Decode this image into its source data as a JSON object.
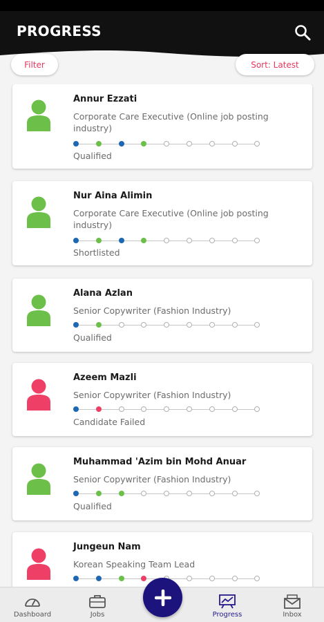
{
  "header": {
    "title": "PROGRESS"
  },
  "filters": {
    "filter_label": "Filter",
    "sort_label": "Sort: Latest"
  },
  "colors": {
    "qualified": "#6cc04a",
    "failed": "#ee3f66",
    "done_step": "#1e68b3",
    "accent": "#e8385e",
    "primary": "#1c137d"
  },
  "candidates": [
    {
      "name": "Annur Ezzati",
      "job": "Corporate Care Executive (Online job posting industry)",
      "status": "Qualified",
      "outcome": "qualified",
      "steps": [
        "done",
        "qualified",
        "done",
        "qualified",
        "pending",
        "pending",
        "pending",
        "pending",
        "pending"
      ]
    },
    {
      "name": "Nur Aina Alimin",
      "job": "Corporate Care Executive (Online job posting industry)",
      "status": "Shortlisted",
      "outcome": "qualified",
      "steps": [
        "done",
        "qualified",
        "done",
        "qualified",
        "pending",
        "pending",
        "pending",
        "pending",
        "pending"
      ]
    },
    {
      "name": "Alana Azlan",
      "job": "Senior Copywriter (Fashion Industry)",
      "status": "Qualified",
      "outcome": "qualified",
      "steps": [
        "done",
        "qualified",
        "pending",
        "pending",
        "pending",
        "pending",
        "pending",
        "pending",
        "pending"
      ]
    },
    {
      "name": "Azeem Mazli",
      "job": "Senior Copywriter (Fashion Industry)",
      "status": "Candidate Failed",
      "outcome": "failed",
      "steps": [
        "done",
        "failed",
        "pending",
        "pending",
        "pending",
        "pending",
        "pending",
        "pending",
        "pending"
      ]
    },
    {
      "name": "Muhammad 'Azim bin Mohd Anuar",
      "job": "Senior Copywriter (Fashion Industry)",
      "status": "Qualified",
      "outcome": "qualified",
      "steps": [
        "done",
        "qualified",
        "qualified",
        "pending",
        "pending",
        "pending",
        "pending",
        "pending",
        "pending"
      ]
    },
    {
      "name": "Jungeun Nam",
      "job": "Korean Speaking Team Lead",
      "status": "",
      "outcome": "failed",
      "steps": [
        "done",
        "done",
        "qualified",
        "failed",
        "pending",
        "pending",
        "pending",
        "pending",
        "pending"
      ]
    }
  ],
  "nav": {
    "items": [
      {
        "label": "Dashboard",
        "icon": "dashboard-icon"
      },
      {
        "label": "Jobs",
        "icon": "briefcase-icon"
      },
      {
        "label": "Progress",
        "icon": "progress-board-icon",
        "active": true
      },
      {
        "label": "Inbox",
        "icon": "inbox-icon"
      }
    ],
    "fab_icon": "plus-icon"
  }
}
